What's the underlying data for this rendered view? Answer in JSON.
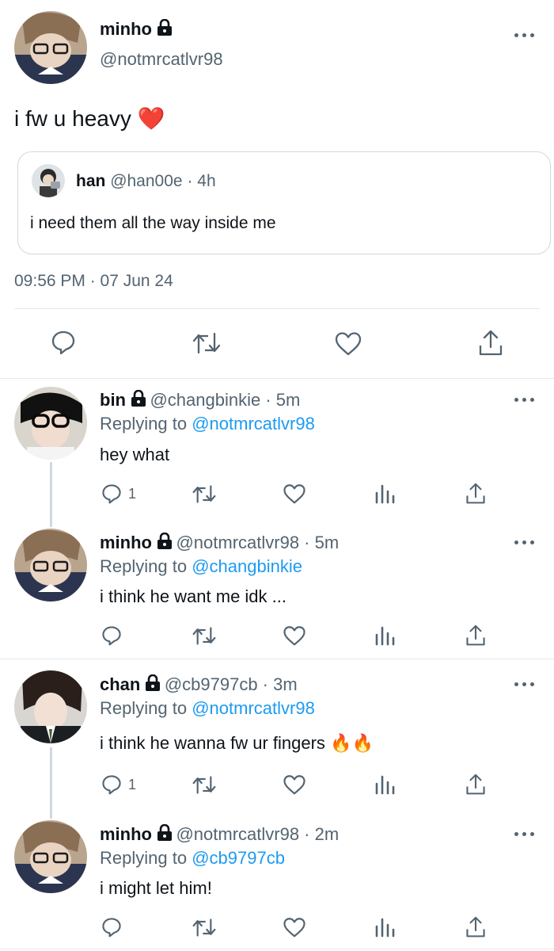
{
  "main_tweet": {
    "name": "minho",
    "handle": "@notmrcatlvr98",
    "text": "i fw u heavy",
    "emoji": "❤️",
    "quote": {
      "name": "han",
      "handle": "@han00e",
      "sep": "·",
      "time": "4h",
      "text": "i need them all the way inside me"
    },
    "timestamp": "09:56 PM · 07 Jun 24",
    "actions": [
      "reply-icon",
      "retweet-icon",
      "like-icon",
      "share-icon"
    ]
  },
  "replies": [
    {
      "name": "bin",
      "handle_time": "@changbinkie · 5m",
      "replying_label": "Replying to",
      "replying_to": "@notmrcatlvr98",
      "text": "hey what",
      "reply_count": "1"
    },
    {
      "name": "minho",
      "handle_time": "@notmrcatlvr98 · 5m",
      "replying_label": "Replying to",
      "replying_to": "@changbinkie",
      "text": "i think he want me idk ...",
      "reply_count": ""
    },
    {
      "name": "chan",
      "handle_time": "@cb9797cb · 3m",
      "replying_label": "Replying to",
      "replying_to": "@notmrcatlvr98",
      "text": "i think he wanna fw ur fingers",
      "emoji": "🔥🔥",
      "reply_count": "1"
    },
    {
      "name": "minho",
      "handle_time": "@notmrcatlvr98 · 2m",
      "replying_label": "Replying to",
      "replying_to": "@cb9797cb",
      "text": "i might let him!",
      "reply_count": ""
    }
  ],
  "colors": {
    "link": "#1d9bf0",
    "muted": "#536471",
    "heart": "#e0245e",
    "fire": "#f4900c"
  }
}
